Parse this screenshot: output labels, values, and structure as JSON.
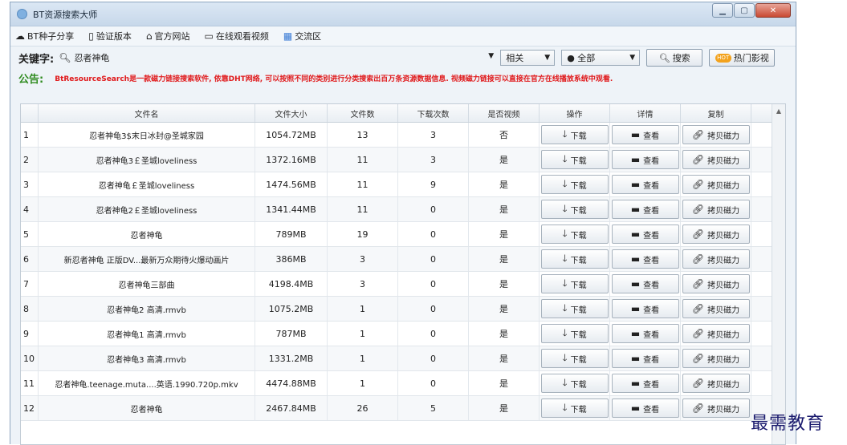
{
  "window": {
    "title": "BT资源搜索大师"
  },
  "menu": [
    {
      "icon": "cloud-upload-icon",
      "glyph": "☁",
      "label": "BT种子分享"
    },
    {
      "icon": "tablet-icon",
      "glyph": "▯",
      "label": "验证版本"
    },
    {
      "icon": "home-icon",
      "glyph": "⌂",
      "label": "官方网站"
    },
    {
      "icon": "monitor-icon",
      "glyph": "▭",
      "label": "在线观看视频"
    },
    {
      "icon": "chat-icon",
      "glyph": "▦",
      "label": "交流区"
    }
  ],
  "search": {
    "label": "关键字:",
    "value": "忍者神龟",
    "sort_option": "相关",
    "category_option": "● 全部",
    "search_button": "搜索",
    "hot_button": "热门影视",
    "hot_badge": "HOT"
  },
  "notice": {
    "label": "公告:",
    "text": "BtResourceSearch是一款磁力链接搜索软件, 依靠DHT网络, 可以按照不同的类别进行分类搜索出百万条资源数据信息. 视频磁力链接可以直接在官方在线播放系统中观看."
  },
  "table": {
    "headers": [
      "",
      "文件名",
      "文件大小",
      "文件数",
      "下载次数",
      "是否视频",
      "操作",
      "详情",
      "复制"
    ],
    "download_label": "下载",
    "view_label": "查看",
    "copy_label": "拷贝磁力",
    "rows": [
      {
        "n": "1",
        "name": "忍者神龟3$末日冰封@圣城家园",
        "size": "1054.72MB",
        "files": "13",
        "downloads": "3",
        "video": "否"
      },
      {
        "n": "2",
        "name": "忍者神龟3￡圣城loveliness",
        "size": "1372.16MB",
        "files": "11",
        "downloads": "3",
        "video": "是"
      },
      {
        "n": "3",
        "name": "忍者神龟￡圣城loveliness",
        "size": "1474.56MB",
        "files": "11",
        "downloads": "9",
        "video": "是"
      },
      {
        "n": "4",
        "name": "忍者神龟2￡圣城loveliness",
        "size": "1341.44MB",
        "files": "11",
        "downloads": "0",
        "video": "是"
      },
      {
        "n": "5",
        "name": "忍者神龟",
        "size": "789MB",
        "files": "19",
        "downloads": "0",
        "video": "是"
      },
      {
        "n": "6",
        "name": "新忍者神龟 正版DV...最新万众期待火爆动画片",
        "size": "386MB",
        "files": "3",
        "downloads": "0",
        "video": "是"
      },
      {
        "n": "7",
        "name": "忍者神龟三部曲",
        "size": "4198.4MB",
        "files": "3",
        "downloads": "0",
        "video": "是"
      },
      {
        "n": "8",
        "name": "忍者神龟2 高清.rmvb",
        "size": "1075.2MB",
        "files": "1",
        "downloads": "0",
        "video": "是"
      },
      {
        "n": "9",
        "name": "忍者神龟1 高清.rmvb",
        "size": "787MB",
        "files": "1",
        "downloads": "0",
        "video": "是"
      },
      {
        "n": "10",
        "name": "忍者神龟3 高清.rmvb",
        "size": "1331.2MB",
        "files": "1",
        "downloads": "0",
        "video": "是"
      },
      {
        "n": "11",
        "name": "忍者神龟.teenage.muta....英语.1990.720p.mkv",
        "size": "4474.88MB",
        "files": "1",
        "downloads": "0",
        "video": "是"
      },
      {
        "n": "12",
        "name": "忍者神龟",
        "size": "2467.84MB",
        "files": "26",
        "downloads": "5",
        "video": "是"
      }
    ]
  },
  "watermark": "最需教育"
}
